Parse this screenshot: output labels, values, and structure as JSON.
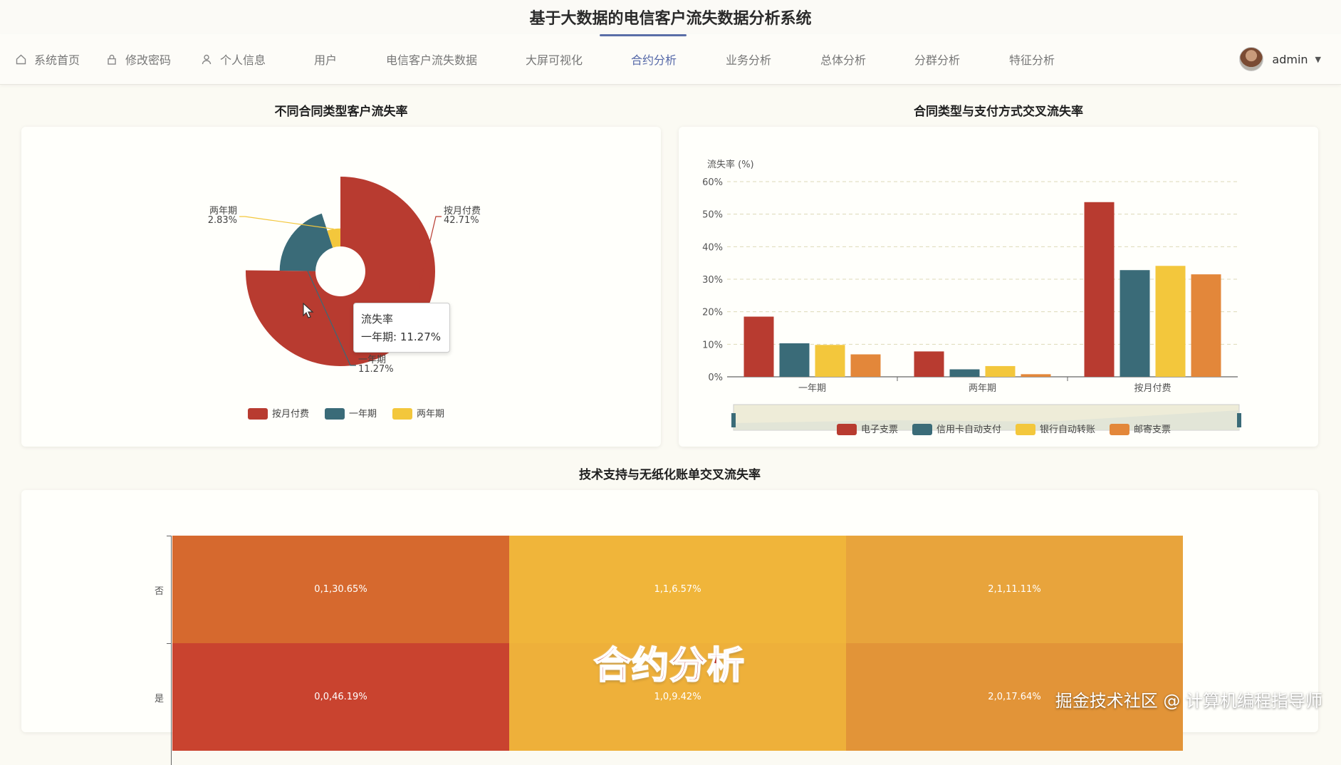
{
  "app": {
    "title": "基于大数据的电信客户流失数据分析系统"
  },
  "nav": {
    "items": [
      {
        "label": "系统首页",
        "icon": "home-icon"
      },
      {
        "label": "修改密码",
        "icon": "lock-icon"
      },
      {
        "label": "个人信息",
        "icon": "person-icon"
      },
      {
        "label": "用户",
        "icon": "grid-icon"
      },
      {
        "label": "电信客户流失数据",
        "icon": "grid-icon"
      },
      {
        "label": "大屏可视化",
        "icon": "grid-icon"
      },
      {
        "label": "合约分析",
        "icon": "grid-icon",
        "active": true
      },
      {
        "label": "业务分析",
        "icon": "grid-icon"
      },
      {
        "label": "总体分析",
        "icon": "grid-icon"
      },
      {
        "label": "分群分析",
        "icon": "grid-icon"
      },
      {
        "label": "特征分析",
        "icon": "grid-icon"
      }
    ],
    "user": {
      "name": "admin"
    }
  },
  "colors": {
    "red": "#b83b30",
    "teal": "#3a6b78",
    "yellow": "#f3c73c",
    "orange": "#e3873a",
    "nav_active": "#5a6ea8"
  },
  "pie_section": {
    "title": "不同合同类型客户流失率",
    "tooltip": {
      "title": "流失率",
      "line": "一年期: 11.27%"
    }
  },
  "bar_section": {
    "title": "合同类型与支付方式交叉流失率"
  },
  "heatmap_section": {
    "title": "技术支持与无纸化账单交叉流失率"
  },
  "chart_data": [
    {
      "type": "pie",
      "title": "不同合同类型客户流失率",
      "variant": "rose (nightingale) donut",
      "slices": [
        {
          "name": "按月付费",
          "value": 42.71,
          "label": "42.71%",
          "color": "#b83b30"
        },
        {
          "name": "一年期",
          "value": 11.27,
          "label": "11.27%",
          "color": "#3a6b78"
        },
        {
          "name": "两年期",
          "value": 2.83,
          "label": "2.83%",
          "color": "#f3c73c"
        }
      ],
      "legend": [
        "按月付费",
        "一年期",
        "两年期"
      ],
      "legend_position": "bottom"
    },
    {
      "type": "bar",
      "title": "合同类型与支付方式交叉流失率",
      "categories": [
        "一年期",
        "两年期",
        "按月付费"
      ],
      "ylabel": "流失率 (%)",
      "ylim": [
        0,
        60
      ],
      "yticks": [
        "0%",
        "10%",
        "20%",
        "30%",
        "40%",
        "50%",
        "60%"
      ],
      "series": [
        {
          "name": "电子支票",
          "values": [
            18.5,
            7.8,
            53.7
          ],
          "color": "#b83b30"
        },
        {
          "name": "信用卡自动支付",
          "values": [
            10.3,
            2.3,
            32.8
          ],
          "color": "#3a6b78"
        },
        {
          "name": "银行自动转账",
          "values": [
            9.8,
            3.3,
            34.1
          ],
          "color": "#f3c73c"
        },
        {
          "name": "邮寄支票",
          "values": [
            6.9,
            0.8,
            31.5
          ],
          "color": "#e3873a"
        }
      ],
      "grid": true,
      "legend_position": "bottom"
    },
    {
      "type": "heatmap",
      "title": "技术支持与无纸化账单交叉流失率",
      "y_categories": [
        "否",
        "是"
      ],
      "cells": [
        {
          "label": "0,1,30.65%",
          "x": 0,
          "y": 0,
          "value": 30.65
        },
        {
          "label": "1,1,6.57%",
          "x": 1,
          "y": 0,
          "value": 6.57
        },
        {
          "label": "2,1,11.11%",
          "x": 2,
          "y": 0,
          "value": 11.11
        },
        {
          "label": "0,0,46.19%",
          "x": 0,
          "y": 1,
          "value": 46.19
        },
        {
          "label": "1,0,9.42%",
          "x": 1,
          "y": 1,
          "value": 9.42
        },
        {
          "label": "2,0,17.64%",
          "x": 2,
          "y": 1,
          "value": 17.64
        }
      ]
    }
  ],
  "overlay": {
    "caption": "合约分析",
    "watermark": "掘金技术社区 @ 计算机编程指导师"
  }
}
